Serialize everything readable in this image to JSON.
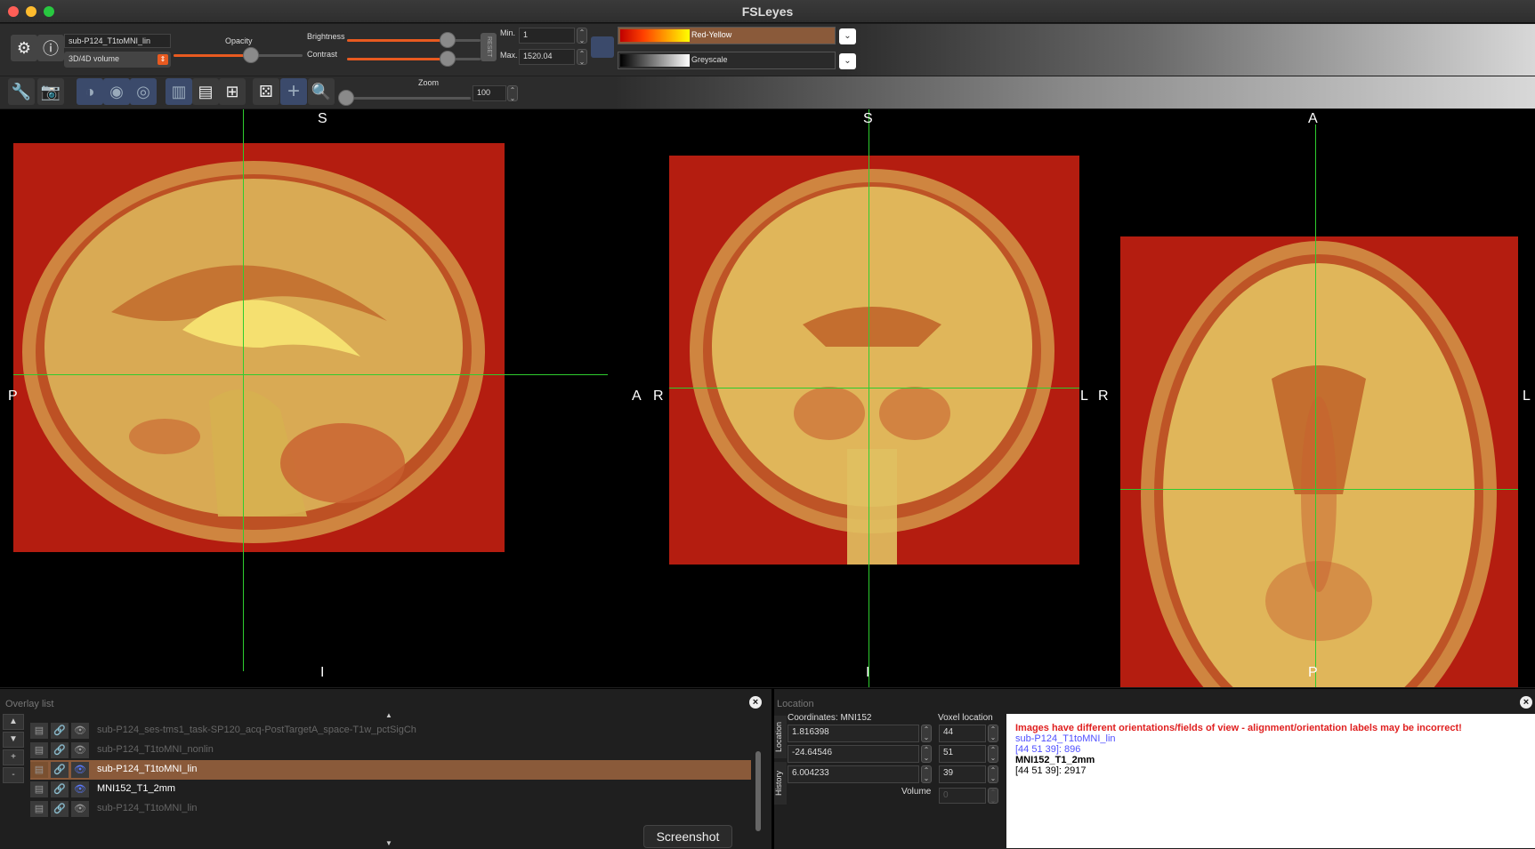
{
  "window": {
    "title": "FSLeyes"
  },
  "colors": {
    "red": "#ff5f57",
    "yellow": "#febc2e",
    "green": "#28c840",
    "accent": "#e85a20",
    "cursor": "#2ecc2e",
    "warning": "#e02020",
    "overlay_blue": "#5050ff"
  },
  "overlay_toolbar": {
    "overlay_name": "sub-P124_T1toMNI_lin",
    "overlay_type": "3D/4D volume",
    "opacity_label": "Opacity",
    "opacity": 0.6,
    "brightness_label": "Brightness",
    "brightness": 0.75,
    "contrast_label": "Contrast",
    "contrast": 0.75,
    "reset_label": "RESET",
    "min_label": "Min.",
    "min_value": "1",
    "max_label": "Max.",
    "max_value": "1520.04",
    "cmap1": "Red-Yellow",
    "cmap2": "Greyscale",
    "icons": [
      "gear-icon",
      "info-icon"
    ]
  },
  "ortho_toolbar": {
    "zoom_label": "Zoom",
    "zoom_value": "100",
    "zoom": 0.0,
    "icons": [
      "wrench-icon",
      "camera-icon",
      "sagittal-view-icon",
      "coronal-view-icon",
      "axial-view-icon",
      "horizontal-layout-icon",
      "vertical-layout-icon",
      "grid-layout-icon",
      "movie-icon",
      "crosshair-icon",
      "zoom-icon"
    ]
  },
  "views": {
    "sagittal": {
      "top": "S",
      "bottom": "I",
      "left": "P",
      "right": "A"
    },
    "coronal": {
      "top": "S",
      "bottom": "I",
      "left": "R",
      "right": "L"
    },
    "axial": {
      "top": "A",
      "bottom": "P",
      "left": "R",
      "right": "L"
    }
  },
  "overlay_list": {
    "title": "Overlay list",
    "items": [
      {
        "name": "sub-P124_ses-tms1_task-SP120_acq-PostTargetA_space-T1w_pctSigCh",
        "selected": false,
        "visible": false
      },
      {
        "name": "sub-P124_T1toMNI_nonlin",
        "selected": false,
        "visible": false
      },
      {
        "name": "sub-P124_T1toMNI_lin",
        "selected": true,
        "visible": true
      },
      {
        "name": "MNI152_T1_2mm",
        "selected": false,
        "visible": true
      },
      {
        "name": "sub-P124_T1toMNI_lin",
        "selected": false,
        "visible": false
      }
    ],
    "buttons": [
      "▲",
      "▼",
      "+",
      "-"
    ],
    "screenshot_label": "Screenshot"
  },
  "location": {
    "title": "Location",
    "tabs": [
      "Location",
      "History"
    ],
    "coord_label": "Coordinates: MNI152",
    "coords": [
      "1.816398",
      "-24.64546",
      "6.004233"
    ],
    "voxel_label": "Voxel location",
    "voxels": [
      "44",
      "51",
      "39"
    ],
    "volume_label": "Volume",
    "volume_value": "0",
    "info": {
      "warning": "Images have different orientations/fields of view - alignment/orientation labels may be incorrect!",
      "ov1_name": "sub-P124_T1toMNI_lin",
      "ov1_value": "[44 51 39]: 896",
      "ov2_name": "MNI152_T1_2mm",
      "ov2_value": "[44 51 39]: 2917"
    }
  }
}
